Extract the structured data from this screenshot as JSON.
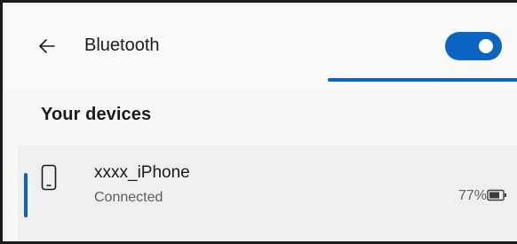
{
  "header": {
    "back_icon": "back-arrow-icon",
    "title": "Bluetooth",
    "toggle_state": "on",
    "accent_color": "#0a64c2"
  },
  "section": {
    "heading": "Your devices"
  },
  "devices": [
    {
      "icon": "phone-icon",
      "name": "xxxx_iPhone",
      "status": "Connected",
      "battery": "77%",
      "battery_icon": "battery-icon"
    }
  ]
}
